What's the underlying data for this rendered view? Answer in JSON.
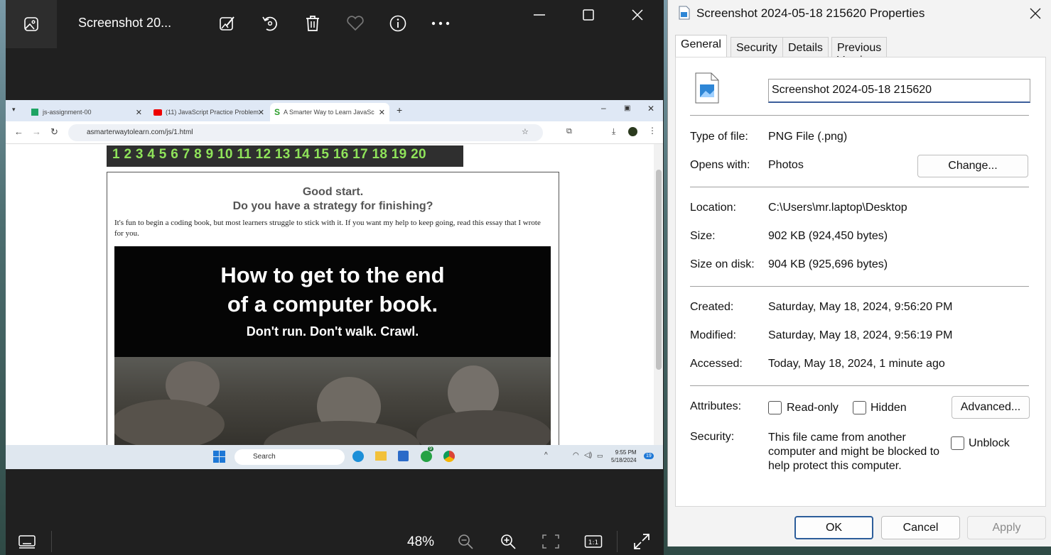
{
  "photos": {
    "title": "Screenshot 20...",
    "zoom": "48%",
    "tools": [
      "edit-image-icon",
      "rotate-icon",
      "delete-icon",
      "favorite-icon",
      "info-icon",
      "more-icon"
    ]
  },
  "browser": {
    "tabs": [
      {
        "label": "js-assignment-00"
      },
      {
        "label": "(11) JavaScript Practice Problem"
      },
      {
        "label": "A Smarter Way to Learn JavaSc"
      }
    ],
    "url": "asmarterwaytolearn.com/js/1.html",
    "chapter_numbers": "1 2 3 4 5 6 7 8 9 10 11 12 13 14 15 16 17 18 19 20",
    "heading_1": "Good start.",
    "heading_2": "Do you have a strategy for finishing?",
    "paragraph": "It's fun to begin a coding book, but most learners struggle to stick with it. If you want my help to keep going, read this essay that I wrote for you.",
    "banner_line_1": "How to get to the end",
    "banner_line_2": "of a computer book.",
    "banner_line_3": "Don't run. Don't walk. Crawl.",
    "taskbar_search": "Search",
    "taskbar_time": "9:55 PM",
    "taskbar_date": "5/18/2024",
    "taskbar_badge": "19",
    "whatsapp_badge": "9"
  },
  "props": {
    "title": "Screenshot 2024-05-18 215620 Properties",
    "tabs": [
      "General",
      "Security",
      "Details",
      "Previous Versions"
    ],
    "filename": "Screenshot 2024-05-18 215620",
    "type_label": "Type of file:",
    "type_value": "PNG File (.png)",
    "opens_label": "Opens with:",
    "opens_value": "Photos",
    "change_button": "Change...",
    "location_label": "Location:",
    "location_value": "C:\\Users\\mr.laptop\\Desktop",
    "size_label": "Size:",
    "size_value": "902 KB (924,450 bytes)",
    "size_disk_label": "Size on disk:",
    "size_disk_value": "904 KB (925,696 bytes)",
    "created_label": "Created:",
    "created_value": "Saturday, May 18, 2024, 9:56:20 PM",
    "modified_label": "Modified:",
    "modified_value": "Saturday, May 18, 2024, 9:56:19 PM",
    "accessed_label": "Accessed:",
    "accessed_value": "Today, May 18, 2024, 1 minute ago",
    "attributes_label": "Attributes:",
    "readonly_label": "Read-only",
    "hidden_label": "Hidden",
    "advanced_button": "Advanced...",
    "security_label": "Security:",
    "security_text": "This file came from another computer and might be blocked to help protect this computer.",
    "unblock_label": "Unblock",
    "ok_button": "OK",
    "cancel_button": "Cancel",
    "apply_button": "Apply"
  },
  "colors": {
    "accent": "#3b5e9b",
    "numbers_green": "#8fe35a"
  }
}
